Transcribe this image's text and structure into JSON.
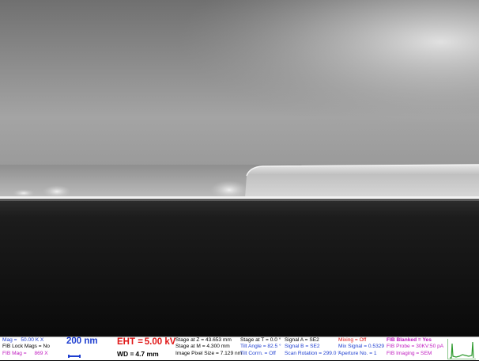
{
  "image": {
    "description_icon": "sem-cross-section-image"
  },
  "info": {
    "mag": {
      "label": "Mag =",
      "value": "50.00 K X"
    },
    "fib_lock_mags": "FIB Lock Mags = No",
    "fib_mag": {
      "label": "FIB Mag =",
      "value": "869 X"
    },
    "scale_bar": "200 nm",
    "eht": {
      "label": "EHT =",
      "value": "5.00 kV"
    },
    "wd": {
      "label": "WD =",
      "value": "4.7 mm"
    },
    "stage_z": "Stage at Z = 43.653 mm",
    "stage_m": "Stage at M = 4.300 mm",
    "image_pixel_size": "Image Pixel Size = 7.129 nm",
    "stage_t": "Stage at T = 0.0 °",
    "tilt_angle": "Tilt Angle = 82.5 °",
    "tilt_corrn": "Tilt Corrn. = Off",
    "signal_a": "Signal A = SE2",
    "signal_b": "Signal B = SE2",
    "scan_rotation": "Scan Rotation = 299.0 °",
    "mixing": "Mixing = Off",
    "mix_signal": "Mix Signal = 0.5329",
    "aperture_no": "Aperture No. = 1",
    "fib_blanked": "FIB Blanked = Yes",
    "fib_probe": "FIB Probe = 30KV:50 pA",
    "fib_imaging": "FIB Imaging = SEM"
  },
  "colors": {
    "blue": "#1f3fd0",
    "red": "#e01818",
    "magenta": "#c01cc0",
    "graph": "#2e9a2e"
  }
}
